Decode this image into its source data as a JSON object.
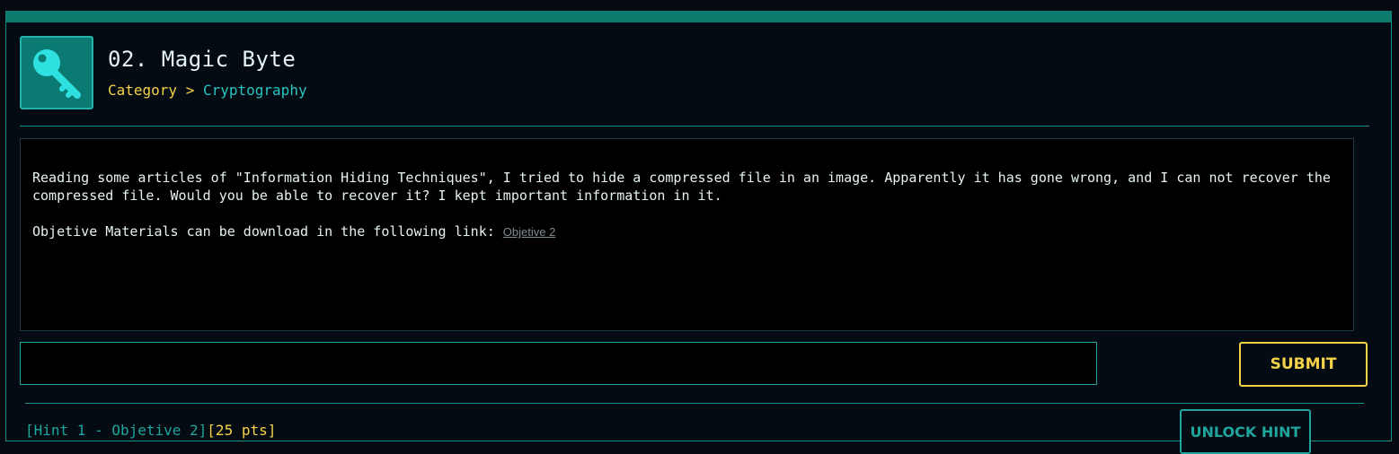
{
  "challenge": {
    "title": "02. Magic Byte",
    "category_label": "Category",
    "separator": ">",
    "category_value": "Cryptography",
    "icon": "key-icon"
  },
  "description": {
    "paragraph1": "Reading some articles of \"Information Hiding Techniques\", I tried to hide a compressed file in an image. Apparently it has gone wrong, and I can not recover the compressed file. Would you be able to recover it? I kept important information in it.",
    "paragraph2_text": "Objetive Materials can be download in the following link:",
    "link_text": "Objetive 2"
  },
  "flag_form": {
    "input_value": "",
    "submit_label": "SUBMIT"
  },
  "hint": {
    "label": "[Hint 1 - Objetive 2]",
    "points": "[25 pts]",
    "unlock_label": "UNLOCK HINT"
  },
  "colors": {
    "accent_teal": "#1fa59d",
    "accent_yellow": "#f4d24a",
    "background": "#040b12"
  }
}
